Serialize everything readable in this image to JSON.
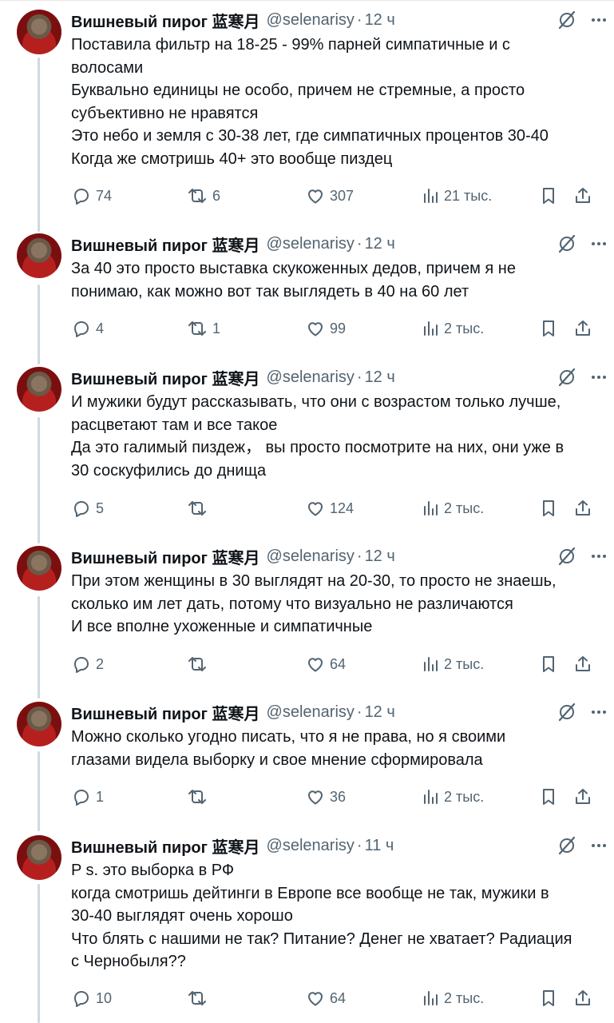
{
  "author": {
    "name": "Вишневый пирог 蓝寒月",
    "handle": "@selenarisy"
  },
  "tweets": [
    {
      "time": "12 ч",
      "lines": [
        "Поставила фильтр на 18-25 - 99% парней симпатичные и с",
        "волосами",
        "Буквально единицы не особо, причем не стремные, а просто",
        "субъективно не нравятся",
        "Это небо и земля с 30-38 лет, где симпатичных процентов 30-40",
        "Когда же смотришь 40+ это вообще пиздец"
      ],
      "replies": "74",
      "reposts": "6",
      "likes": "307",
      "views": "21 тыс."
    },
    {
      "time": "12 ч",
      "lines": [
        "За 40 это просто выставка скукоженных дедов, причем я не",
        "понимаю, как можно вот так выглядеть в 40 на 60 лет"
      ],
      "replies": "4",
      "reposts": "1",
      "likes": "99",
      "views": "2 тыс."
    },
    {
      "time": "12 ч",
      "lines": [
        "И мужики будут рассказывать, что они с возрастом только лучше,",
        "расцветают там и все такое",
        "Да это галимый пиздеж， вы просто посмотрите на них, они уже в",
        "30 соскуфились до днища"
      ],
      "replies": "5",
      "reposts": "",
      "likes": "124",
      "views": "2 тыс."
    },
    {
      "time": "12 ч",
      "lines": [
        "При этом женщины в 30 выглядят на 20-30, то просто не знаешь,",
        "сколько им лет дать, потому что визуально не различаются",
        "И все вполне ухоженные и симпатичные"
      ],
      "replies": "2",
      "reposts": "",
      "likes": "64",
      "views": "2 тыс."
    },
    {
      "time": "12 ч",
      "lines": [
        "Можно сколько угодно писать, что я не права, но я своими",
        "глазами видела выборку и свое мнение сформировала"
      ],
      "replies": "1",
      "reposts": "",
      "likes": "36",
      "views": "2 тыс."
    },
    {
      "time": "11 ч",
      "lines": [
        "P s. это выборка в РФ",
        "когда смотришь дейтинги в Европе все вообще не так, мужики в",
        "30-40 выглядят очень хорошо",
        "Что блять с нашими не так? Питание? Денег не хватает? Радиация",
        "с Чернобыля??"
      ],
      "replies": "10",
      "reposts": "",
      "likes": "64",
      "views": "2 тыс."
    }
  ],
  "colors": {
    "text": "#0f1419",
    "secondary": "#536471",
    "thread_line": "#cfd9de"
  },
  "icons": [
    "grok-icon",
    "more-icon",
    "reply-icon",
    "repost-icon",
    "like-icon",
    "views-icon",
    "bookmark-icon",
    "share-icon"
  ]
}
